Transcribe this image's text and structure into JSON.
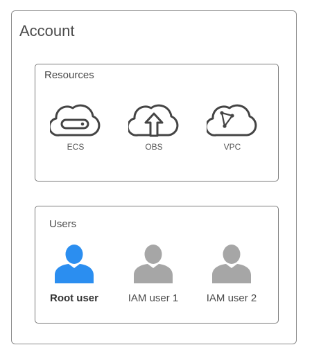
{
  "account": {
    "title": "Account"
  },
  "resources": {
    "title": "Resources",
    "items": [
      {
        "label": "ECS",
        "icon": "ecs-cloud-icon"
      },
      {
        "label": "OBS",
        "icon": "obs-cloud-upload-icon"
      },
      {
        "label": "VPC",
        "icon": "vpc-cloud-network-icon"
      }
    ]
  },
  "users": {
    "title": "Users",
    "items": [
      {
        "label": "Root user",
        "icon": "user-icon",
        "color": "#2b8ef0"
      },
      {
        "label": "IAM user 1",
        "icon": "user-icon",
        "color": "#a6a6a6"
      },
      {
        "label": "IAM user 2",
        "icon": "user-icon",
        "color": "#a6a6a6"
      }
    ]
  },
  "colors": {
    "border": "#8a8a8a",
    "root_user": "#2b8ef0",
    "iam_user": "#a6a6a6",
    "icon_stroke": "#444444"
  }
}
